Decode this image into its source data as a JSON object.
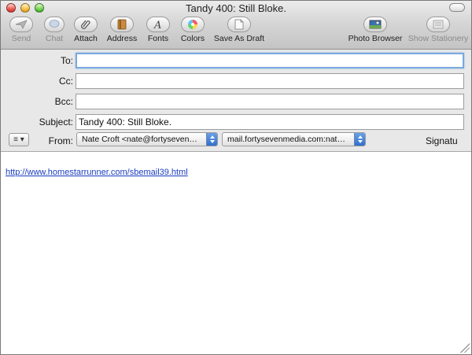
{
  "window": {
    "title": "Tandy 400: Still Bloke."
  },
  "toolbar": {
    "send": {
      "label": "Send",
      "icon": "send-icon",
      "enabled": false
    },
    "chat": {
      "label": "Chat",
      "icon": "chat-icon",
      "enabled": false
    },
    "attach": {
      "label": "Attach",
      "icon": "paperclip-icon",
      "enabled": true
    },
    "address": {
      "label": "Address",
      "icon": "address-book-icon",
      "enabled": true
    },
    "fonts": {
      "label": "Fonts",
      "icon": "fonts-icon",
      "enabled": true
    },
    "colors": {
      "label": "Colors",
      "icon": "color-wheel-icon",
      "enabled": true
    },
    "save_draft": {
      "label": "Save As Draft",
      "icon": "document-icon",
      "enabled": true
    },
    "photo_browser": {
      "label": "Photo Browser",
      "icon": "photo-icon",
      "enabled": true
    },
    "show_stationery": {
      "label": "Show Stationery",
      "icon": "stationery-icon",
      "enabled": false
    }
  },
  "fields": {
    "to_label": "To:",
    "to_value": "",
    "cc_label": "Cc:",
    "cc_value": "",
    "bcc_label": "Bcc:",
    "bcc_value": "",
    "subject_label": "Subject:",
    "subject_value": "Tandy 400: Still Bloke.",
    "from_label": "From:",
    "from_value": "Nate Croft <nate@fortyseven…",
    "account_value": "mail.fortysevenmedia.com:nat…",
    "signature_label": "Signatu",
    "menu_glyph": "≡ ▾"
  },
  "message": {
    "link_text": "http://www.homestarrunner.com/sbemail39.html"
  },
  "colors": {
    "link": "#1a3dbf",
    "focus_ring": "#7aa9df",
    "popup_accent": "#2f6fcf"
  }
}
